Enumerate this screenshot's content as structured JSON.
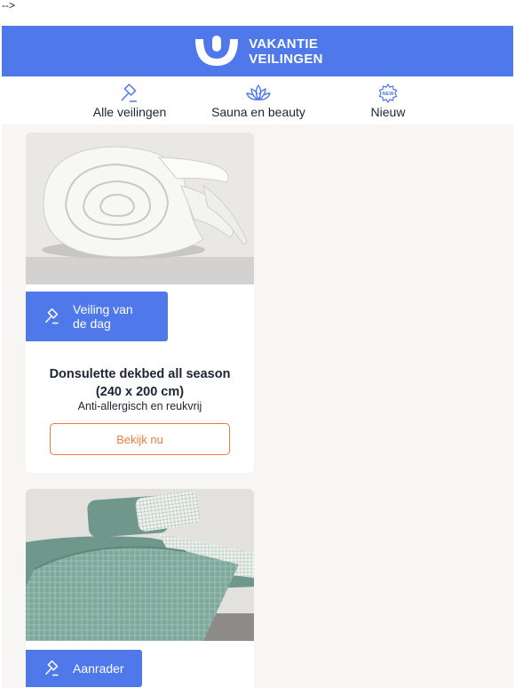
{
  "stray_text": "-->",
  "brand": {
    "line1": "VAKANTIE",
    "line2": "VEILINGEN",
    "color": "#4f78ea"
  },
  "nav": [
    {
      "label": "Alle veilingen",
      "icon": "gavel-icon"
    },
    {
      "label": "Sauna en beauty",
      "icon": "lotus-icon"
    },
    {
      "label": "Nieuw",
      "icon": "new-badge-icon",
      "icon_text": "NEW"
    }
  ],
  "cards": [
    {
      "badge": "Veiling van\nde dag",
      "title": "Donsulette dekbed all season\n(240 x 200 cm)",
      "subtitle": "Anti-allergisch en reukvrij",
      "cta": "Bekijk nu",
      "image": "rolled white duvet"
    },
    {
      "badge": "Aanrader",
      "image": "bed with green checked duvet cover"
    }
  ],
  "colors": {
    "accent": "#4f78ea",
    "cta": "#f07a3c",
    "text": "#1c2533",
    "background": "#f7f6f4"
  }
}
